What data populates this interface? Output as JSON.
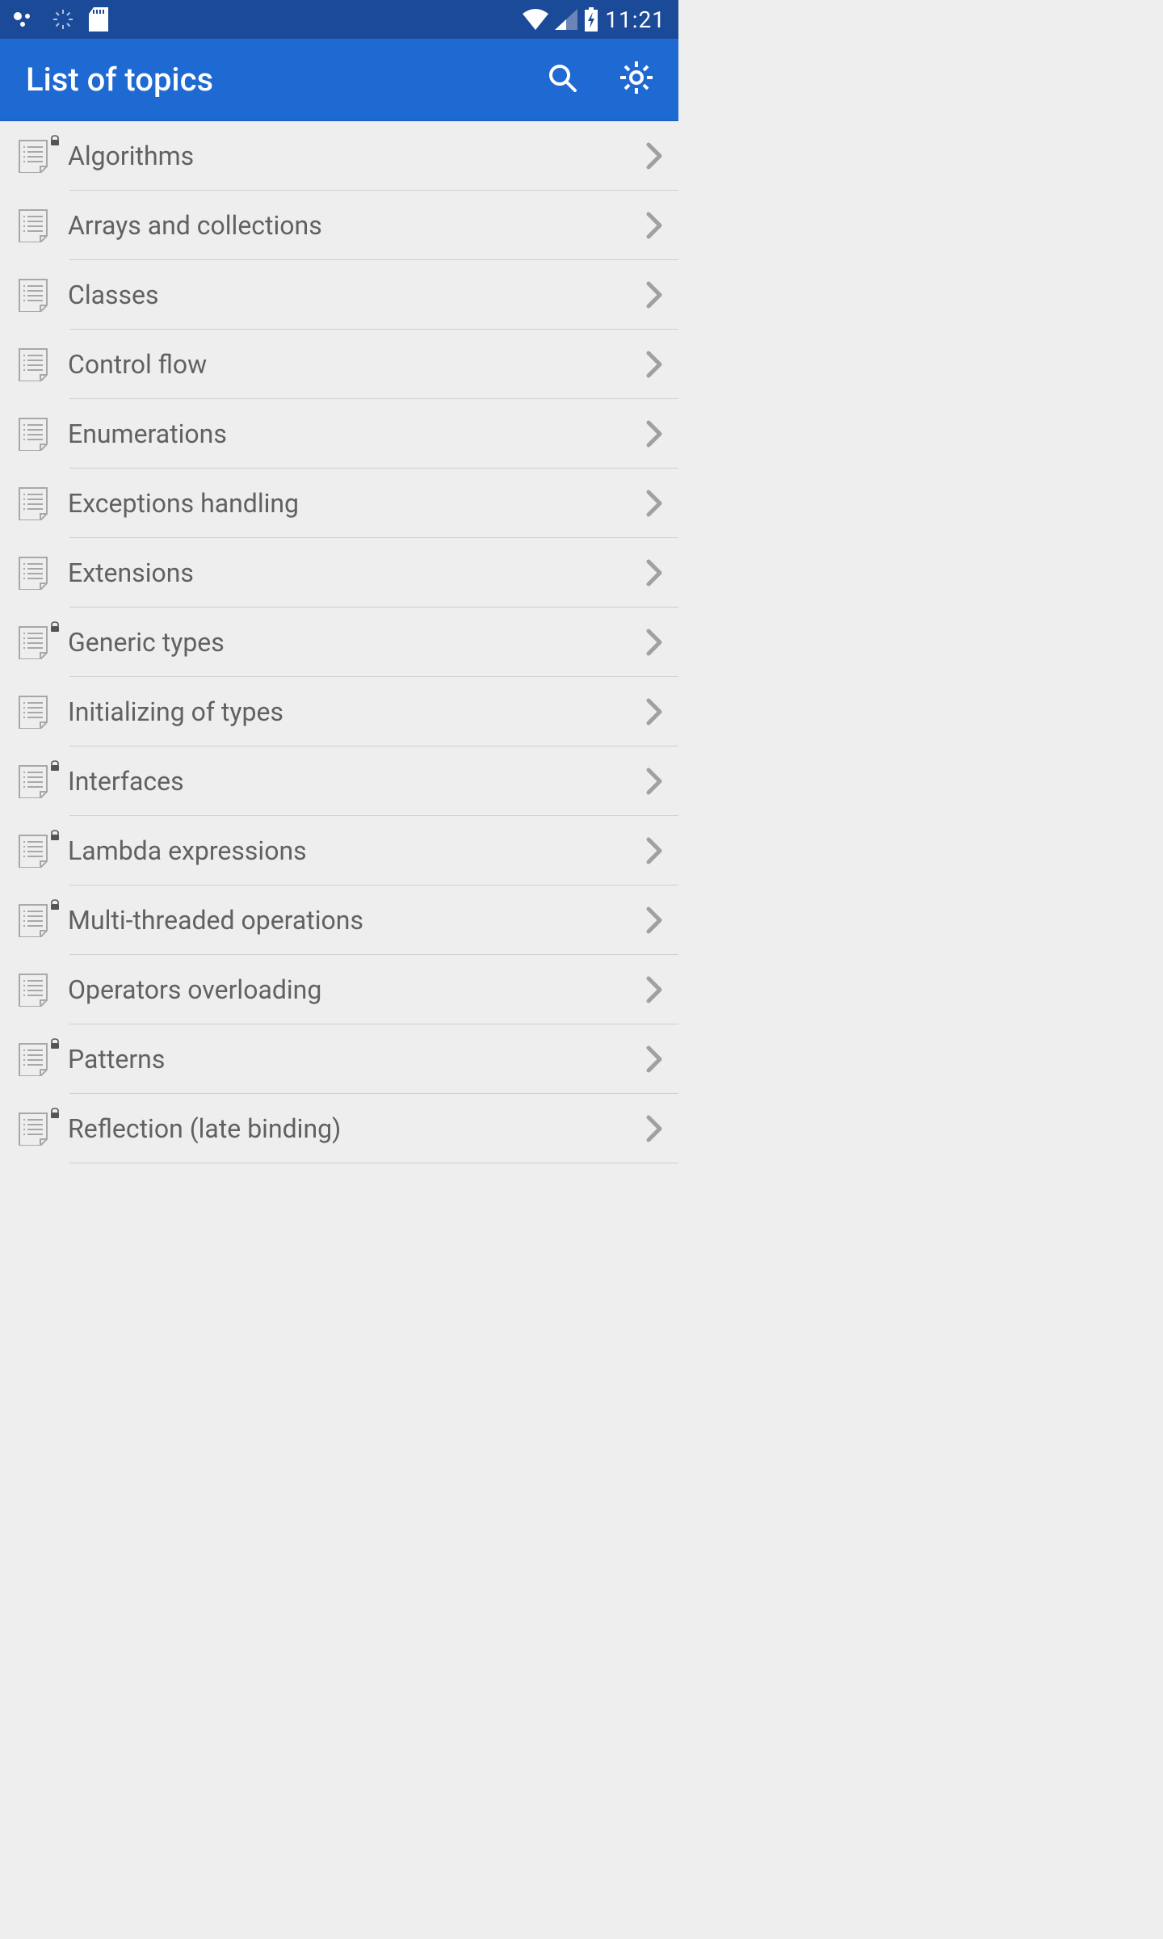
{
  "status": {
    "time": "11:21"
  },
  "header": {
    "title": "List of topics"
  },
  "topics": [
    {
      "label": "Algorithms",
      "locked": true
    },
    {
      "label": "Arrays and collections",
      "locked": false
    },
    {
      "label": "Classes",
      "locked": false
    },
    {
      "label": "Control flow",
      "locked": false
    },
    {
      "label": "Enumerations",
      "locked": false
    },
    {
      "label": "Exceptions handling",
      "locked": false
    },
    {
      "label": "Extensions",
      "locked": false
    },
    {
      "label": "Generic types",
      "locked": true
    },
    {
      "label": "Initializing of types",
      "locked": false
    },
    {
      "label": "Interfaces",
      "locked": true
    },
    {
      "label": "Lambda expressions",
      "locked": true
    },
    {
      "label": "Multi-threaded operations",
      "locked": true
    },
    {
      "label": "Operators overloading",
      "locked": false
    },
    {
      "label": "Patterns",
      "locked": true
    },
    {
      "label": "Reflection (late binding)",
      "locked": true
    }
  ]
}
